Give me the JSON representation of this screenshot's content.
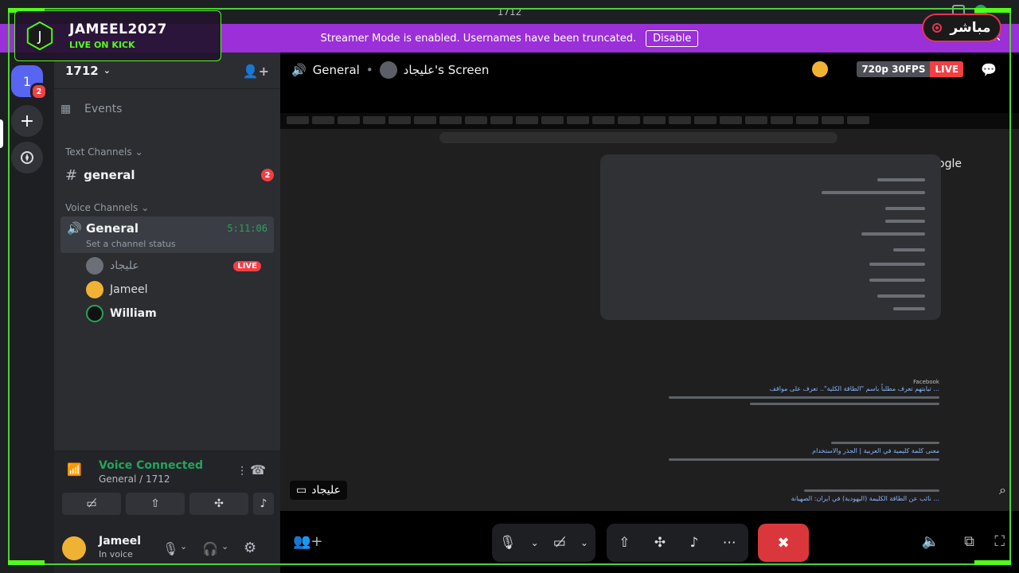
{
  "titlebar": {
    "title": "1712"
  },
  "banner": {
    "message": "Streamer Mode is enabled. Usernames have been truncated.",
    "disable_label": "Disable"
  },
  "overlay": {
    "channel_name": "JAMEEL2027",
    "status": "LIVE ON KICK",
    "live_label": "مباشر",
    "accent": "#53fc18"
  },
  "rail": {
    "server_badge": "2"
  },
  "sidebar": {
    "server_name": "1712",
    "events_label": "Events",
    "text_category": "Text Channels",
    "text_channel": "general",
    "text_badge": "2",
    "voice_category": "Voice Channels",
    "voice_channel": "General",
    "voice_timer": "5:11:06",
    "voice_status_placeholder": "Set a channel status",
    "users": [
      {
        "name": "عليجاد",
        "live": "LIVE"
      },
      {
        "name": "Jameel"
      },
      {
        "name": "William"
      }
    ]
  },
  "voice_panel": {
    "status": "Voice Connected",
    "location": "General / 1712"
  },
  "user_panel": {
    "name": "Jameel",
    "status": "In voice"
  },
  "main": {
    "channel": "General",
    "screen_owner": "عليجاد's Screen",
    "resolution": "720p 30FPS",
    "live_label": "LIVE",
    "streamer_tag": "عليجاد"
  },
  "stream": {
    "google_logo": "Google",
    "result1_title": "تيابتهم تعرف مطلباً باسم \"الطاقة الكلية\".. تعرف على مواقف ...",
    "result2_title": "معنى كلمة كليمية في العربية | الجذر والاستخدام",
    "result3_title": "نائب عن الطاقة الكليمة (اليهودية) في ايران: الصهيانة ...",
    "result1_source": "Facebook"
  },
  "colors": {
    "banner": "#9b2fd8",
    "voice_green": "#23a55a",
    "danger": "#da373c",
    "blurple": "#5865f2"
  }
}
